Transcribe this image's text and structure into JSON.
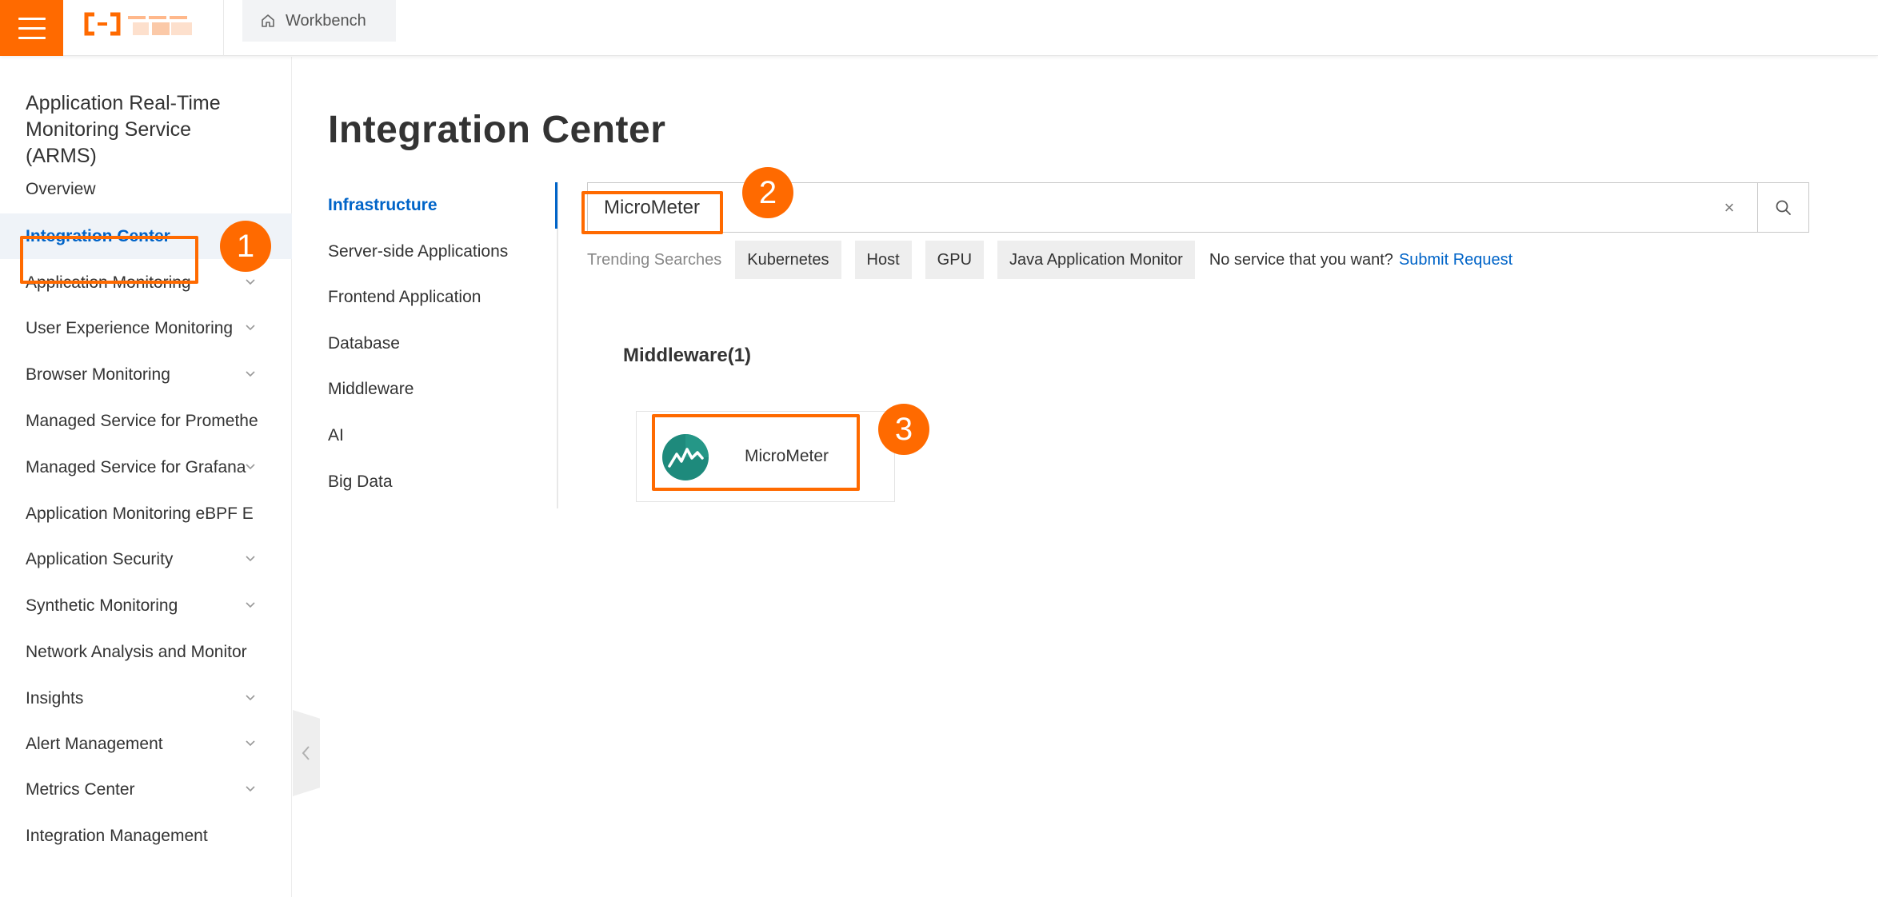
{
  "topbar": {
    "workbench_label": "Workbench"
  },
  "sidebar": {
    "title": "Application Real-Time Monitoring Service (ARMS)",
    "items": [
      {
        "label": "Overview",
        "has_chevron": false,
        "active": false
      },
      {
        "label": "Integration Center",
        "has_chevron": false,
        "active": true
      },
      {
        "label": "Application Monitoring",
        "has_chevron": true,
        "active": false
      },
      {
        "label": "User Experience Monitoring",
        "has_chevron": true,
        "active": false
      },
      {
        "label": "Browser Monitoring",
        "has_chevron": true,
        "active": false
      },
      {
        "label": "Managed Service for Promethe",
        "has_chevron": false,
        "active": false
      },
      {
        "label": "Managed Service for Grafana",
        "has_chevron": true,
        "active": false
      },
      {
        "label": "Application Monitoring eBPF E",
        "has_chevron": false,
        "active": false
      },
      {
        "label": "Application Security",
        "has_chevron": true,
        "active": false
      },
      {
        "label": "Synthetic Monitoring",
        "has_chevron": true,
        "active": false
      },
      {
        "label": "Network Analysis and Monitor",
        "has_chevron": false,
        "active": false
      },
      {
        "label": "Insights",
        "has_chevron": true,
        "active": false
      },
      {
        "label": "Alert Management",
        "has_chevron": true,
        "active": false
      },
      {
        "label": "Metrics Center",
        "has_chevron": true,
        "active": false
      },
      {
        "label": "Integration Management",
        "has_chevron": false,
        "active": false
      }
    ]
  },
  "main": {
    "page_title": "Integration Center",
    "categories": [
      {
        "label": "Infrastructure",
        "active": true
      },
      {
        "label": "Server-side Applications",
        "active": false
      },
      {
        "label": "Frontend Application",
        "active": false
      },
      {
        "label": "Database",
        "active": false
      },
      {
        "label": "Middleware",
        "active": false
      },
      {
        "label": "AI",
        "active": false
      },
      {
        "label": "Big Data",
        "active": false
      }
    ],
    "search": {
      "value": "MicroMeter",
      "clear_glyph": "×"
    },
    "trending": {
      "label": "Trending Searches",
      "tags": [
        "Kubernetes",
        "Host",
        "GPU",
        "Java Application Monitor"
      ],
      "no_service_text": "No service that you want?",
      "submit_link": "Submit Request"
    },
    "results": {
      "section_heading": "Middleware(1)",
      "cards": [
        {
          "name": "MicroMeter",
          "icon": "micrometer-logo-icon"
        }
      ]
    }
  },
  "annotations": {
    "badges": [
      "1",
      "2",
      "3"
    ]
  },
  "colors": {
    "brand_orange": "#ff6a00",
    "link_blue": "#0064c8",
    "active_bg": "#eff3f8",
    "micrometer_teal": "#1e8a7c"
  }
}
